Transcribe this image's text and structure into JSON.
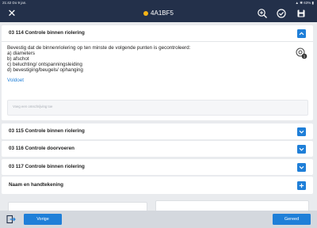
{
  "status_bar": {
    "time_date": "21:42  Do 9 jan.",
    "right_info": "▲ ✱ 63% ▮"
  },
  "nav": {
    "title": "4A1BF5",
    "close_icon": "close-icon",
    "actions": [
      "search-zoom-icon",
      "check-circle-icon",
      "save-icon"
    ],
    "title_dot_color": "#f5b416"
  },
  "sections": [
    {
      "title": "03 114 Controle binnen riolering",
      "expanded": true,
      "instruction_lines": [
        "Bevestig dat de binnenriolering op ten minste de volgende punten is gecontroleerd:",
        "a) diameters",
        "b) afschot",
        "c) beluchting/ ontspanningsleiding",
        "d) bevestiging/beugels/ ophanging"
      ],
      "answer": "Voldoet",
      "description_placeholder": "Voeg een omschrijving toe",
      "photo_count": "1"
    },
    {
      "title": "03 115 Controle binnen riolering",
      "expanded": false
    },
    {
      "title": "03 116 Controle doorvoeren",
      "expanded": false
    },
    {
      "title": "03 117 Controle binnen riolering",
      "expanded": false
    },
    {
      "title": "Naam en handtekening",
      "expanded": false
    }
  ],
  "footer": {
    "prev_label": "Vorige",
    "done_label": "Gereed"
  },
  "colors": {
    "nav_bg": "#23304a",
    "accent": "#1f7fd8",
    "page_bg": "#e9ebee"
  }
}
